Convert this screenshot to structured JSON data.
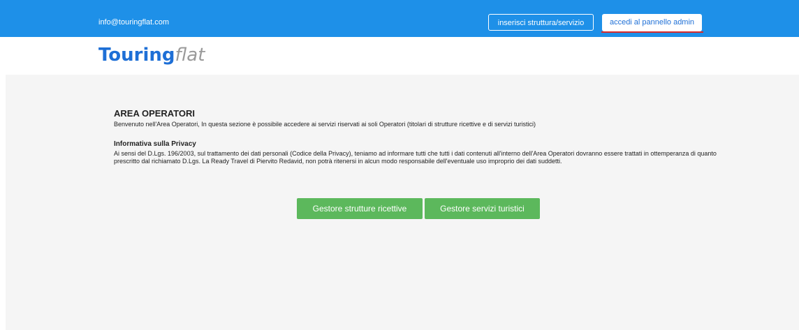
{
  "topbar": {
    "email": "info@touringflat.com",
    "insert_label": "inserisci struttura/servizio",
    "admin_label": "accedi al pannello admin",
    "background_color": "#1e90e8"
  },
  "logo": {
    "strong": "Touring",
    "light": "flat"
  },
  "area": {
    "title": "AREA OPERATORI",
    "description": "Benvenuto nell'Area Operatori, In questa sezione è possibile accedere ai servizi riservati ai soli Operatori (titolari di strutture ricettive e di servizi turistici)"
  },
  "privacy": {
    "title": "Informativa sulla Privacy",
    "text": "Ai sensi del D.Lgs. 196/2003, sul trattamento dei dati personali (Codice della Privacy), teniamo ad informare tutti che tutti i dati contenuti all'interno dell'Area Operatori dovranno essere trattati in ottemperanza di quanto prescritto dal richiamato D.Lgs. La Ready Travel di Piervito Redavid, non potrà ritenersi in alcun modo responsabile dell'eventuale uso improprio dei dati suddetti."
  },
  "actions": {
    "strutture_label": "Gestore strutture ricettive",
    "servizi_label": "Gestore servizi turistici",
    "button_color": "#5cb85c"
  }
}
